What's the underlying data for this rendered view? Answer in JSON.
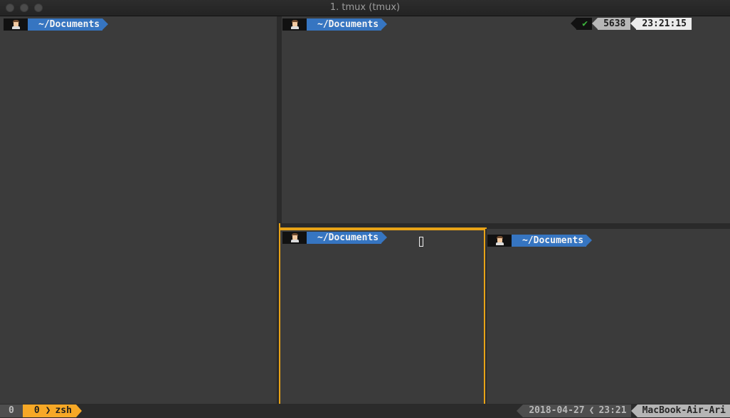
{
  "window": {
    "title": "1. tmux (tmux)"
  },
  "colors": {
    "terminal_bg": "#3b3b3b",
    "active_pane_border": "#e8a317",
    "prompt_dir_bg": "#3675c1",
    "status_window_bg": "#f7a826"
  },
  "panes": [
    {
      "id": "pane-1",
      "prompt": {
        "user_icon": "user-avatar-icon",
        "dir": "~/Documents"
      },
      "active": false
    },
    {
      "id": "pane-2",
      "prompt": {
        "user_icon": "user-avatar-icon",
        "dir": "~/Documents"
      },
      "active": false,
      "right_prompt": {
        "status_icon": "check-icon",
        "status": "✔",
        "pid": "5638",
        "time": "23:21:15"
      }
    },
    {
      "id": "pane-3",
      "prompt": {
        "user_icon": "user-avatar-icon",
        "dir": "~/Documents"
      },
      "active": true
    },
    {
      "id": "pane-4",
      "prompt": {
        "user_icon": "user-avatar-icon",
        "dir": "~/Documents"
      },
      "active": false
    }
  ],
  "statusbar": {
    "session": "0",
    "window_index": "0",
    "window_sep": "❯",
    "window_name": "zsh",
    "date": "2018-04-27",
    "date_sep": "❮",
    "time": "23:21",
    "host": "MacBook-Air-Ari"
  }
}
